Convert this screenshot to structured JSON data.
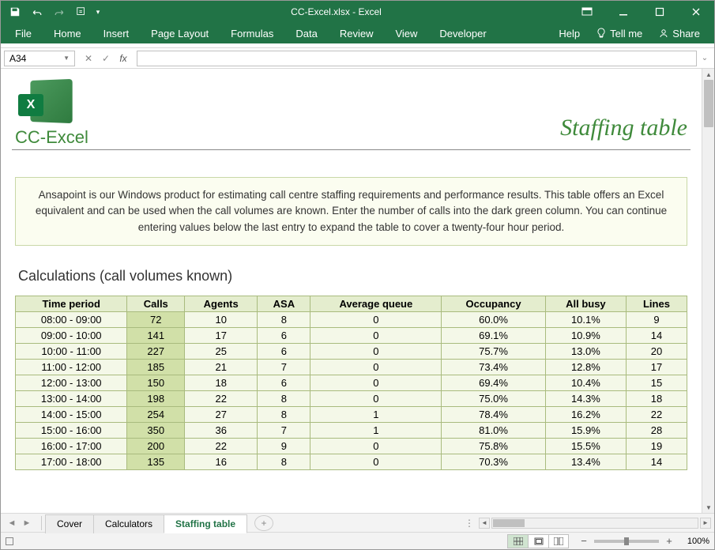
{
  "window": {
    "title": "CC-Excel.xlsx  -  Excel"
  },
  "ribbon": {
    "tabs": [
      "File",
      "Home",
      "Insert",
      "Page Layout",
      "Formulas",
      "Data",
      "Review",
      "View",
      "Developer"
    ],
    "help": "Help",
    "tellme": "Tell me",
    "share": "Share"
  },
  "formula": {
    "nameBox": "A34",
    "value": ""
  },
  "page": {
    "logo_text": "CC-Excel",
    "title": "Staffing table",
    "info": "Ansapoint is our Windows product for estimating call centre staffing requirements and performance results. This table offers an Excel equivalent and can be used when the call volumes are known. Enter the number of calls into the dark green column. You can continue entering values below the last entry to expand the table to cover a twenty-four hour period.",
    "section_title": "Calculations (call volumes known)"
  },
  "table": {
    "headers": [
      "Time period",
      "Calls",
      "Agents",
      "ASA",
      "Average queue",
      "Occupancy",
      "All busy",
      "Lines"
    ],
    "rows": [
      {
        "period": "08:00   -   09:00",
        "calls": "72",
        "agents": "10",
        "asa": "8",
        "avgq": "0",
        "occ": "60.0%",
        "busy": "10.1%",
        "lines": "9"
      },
      {
        "period": "09:00   -   10:00",
        "calls": "141",
        "agents": "17",
        "asa": "6",
        "avgq": "0",
        "occ": "69.1%",
        "busy": "10.9%",
        "lines": "14"
      },
      {
        "period": "10:00   -   11:00",
        "calls": "227",
        "agents": "25",
        "asa": "6",
        "avgq": "0",
        "occ": "75.7%",
        "busy": "13.0%",
        "lines": "20"
      },
      {
        "period": "11:00   -   12:00",
        "calls": "185",
        "agents": "21",
        "asa": "7",
        "avgq": "0",
        "occ": "73.4%",
        "busy": "12.8%",
        "lines": "17"
      },
      {
        "period": "12:00   -   13:00",
        "calls": "150",
        "agents": "18",
        "asa": "6",
        "avgq": "0",
        "occ": "69.4%",
        "busy": "10.4%",
        "lines": "15"
      },
      {
        "period": "13:00   -   14:00",
        "calls": "198",
        "agents": "22",
        "asa": "8",
        "avgq": "0",
        "occ": "75.0%",
        "busy": "14.3%",
        "lines": "18"
      },
      {
        "period": "14:00   -   15:00",
        "calls": "254",
        "agents": "27",
        "asa": "8",
        "avgq": "1",
        "occ": "78.4%",
        "busy": "16.2%",
        "lines": "22"
      },
      {
        "period": "15:00   -   16:00",
        "calls": "350",
        "agents": "36",
        "asa": "7",
        "avgq": "1",
        "occ": "81.0%",
        "busy": "15.9%",
        "lines": "28"
      },
      {
        "period": "16:00   -   17:00",
        "calls": "200",
        "agents": "22",
        "asa": "9",
        "avgq": "0",
        "occ": "75.8%",
        "busy": "15.5%",
        "lines": "19"
      },
      {
        "period": "17:00   -   18:00",
        "calls": "135",
        "agents": "16",
        "asa": "8",
        "avgq": "0",
        "occ": "70.3%",
        "busy": "13.4%",
        "lines": "14"
      }
    ]
  },
  "sheetTabs": {
    "tabs": [
      "Cover",
      "Calculators",
      "Staffing table"
    ],
    "active": 2
  },
  "status": {
    "zoom": "100%"
  }
}
